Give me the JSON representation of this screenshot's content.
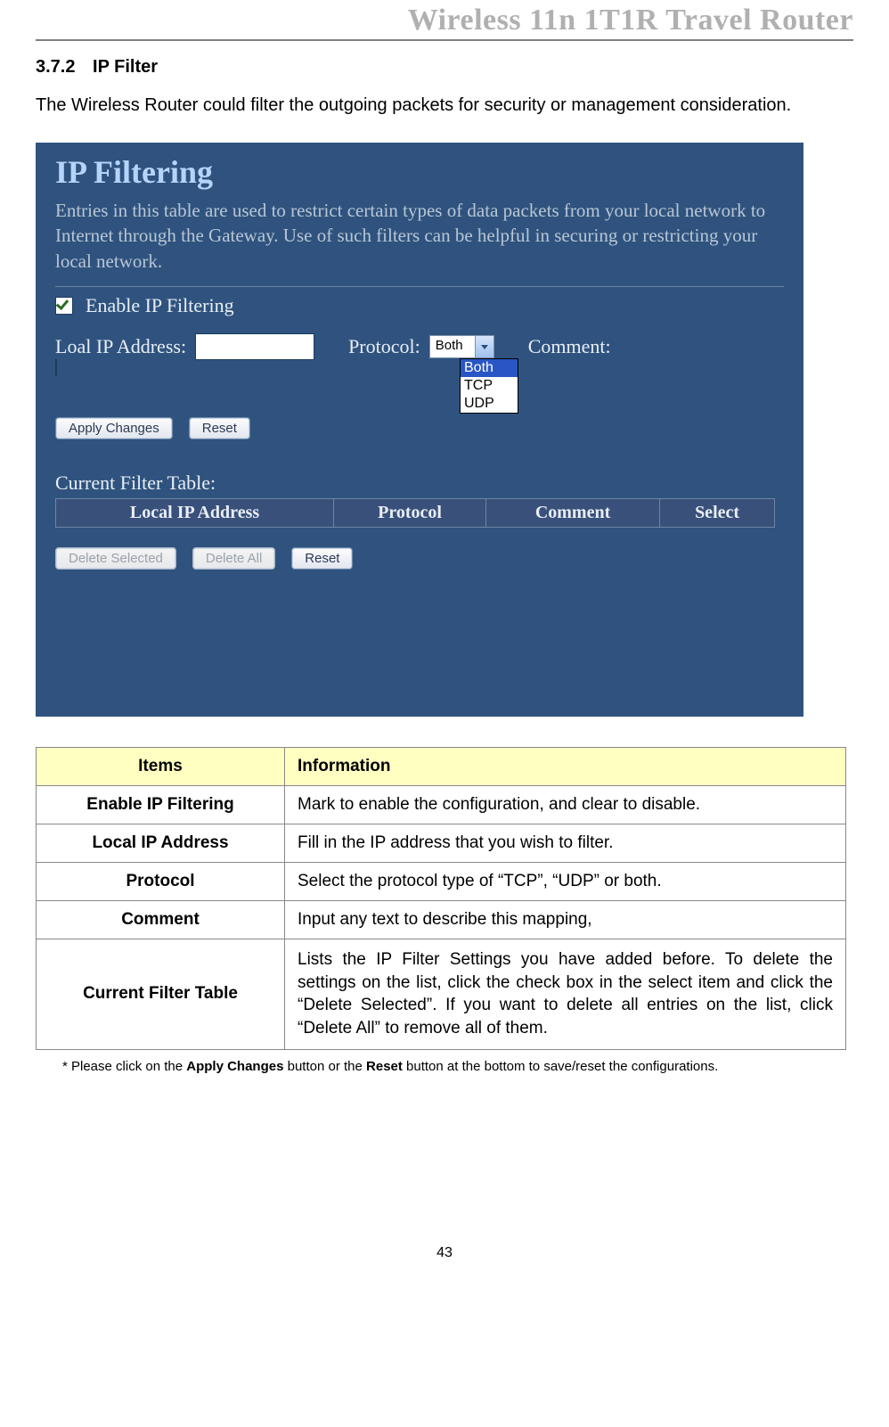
{
  "running_head": "Wireless 11n 1T1R Travel Router",
  "section": {
    "number": "3.7.2",
    "title": "IP Filter"
  },
  "intro": "The Wireless Router could filter the outgoing packets for security or management consideration.",
  "shot": {
    "title": "IP Filtering",
    "desc": "Entries in this table are used to restrict certain types of data packets from your local network to Internet through the Gateway. Use of such filters can be helpful in securing or restricting your local network.",
    "enable_label": "Enable IP Filtering",
    "local_ip_label": "Loal IP Address:",
    "protocol_label": "Protocol:",
    "comment_label": "Comment:",
    "protocol_selected": "Both",
    "protocol_options": [
      "Both",
      "TCP",
      "UDP"
    ],
    "apply_btn": "Apply Changes",
    "reset_btn": "Reset",
    "table_title": "Current Filter Table:",
    "cols": [
      "Local IP Address",
      "Protocol",
      "Comment",
      "Select"
    ],
    "delete_selected": "Delete Selected",
    "delete_all": "Delete All",
    "reset2": "Reset"
  },
  "items_table": {
    "header": {
      "items": "Items",
      "info": "Information"
    },
    "rows": [
      {
        "item": "Enable IP Filtering",
        "info": "Mark to enable the configuration, and clear to disable."
      },
      {
        "item": "Local IP Address",
        "info": "Fill in the IP address that you wish to filter."
      },
      {
        "item": "Protocol",
        "info": "Select the protocol type of “TCP”, “UDP” or both."
      },
      {
        "item": "Comment",
        "info": "Input any text to describe this mapping,"
      },
      {
        "item": "Current Filter Table",
        "info": "Lists the IP Filter Settings you have added before. To delete the settings on the list, click the check box in the select item and click the “Delete Selected”. If you want to delete all entries on the list, click “Delete All” to remove all of them."
      }
    ]
  },
  "footnote": {
    "prefix": "* Please click on the ",
    "b1": "Apply Changes",
    "mid": " button or the ",
    "b2": "Reset",
    "suffix": " button at the bottom to save/reset the configurations."
  },
  "page_no": "43"
}
